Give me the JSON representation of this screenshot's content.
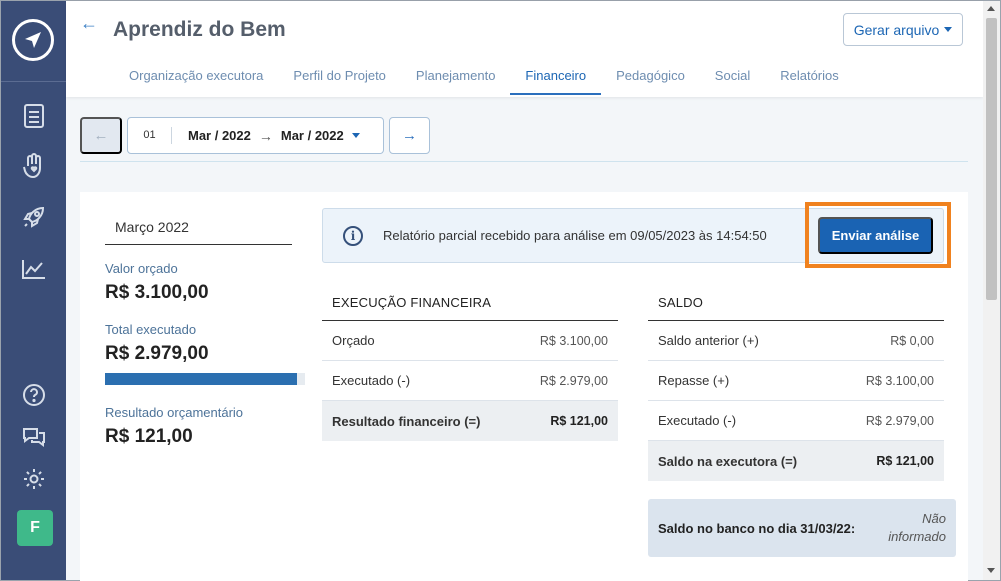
{
  "header": {
    "title": "Aprendiz do Bem",
    "generate_button": "Gerar arquivo"
  },
  "tabs": [
    {
      "label": "Organização executora"
    },
    {
      "label": "Perfil do Projeto"
    },
    {
      "label": "Planejamento"
    },
    {
      "label": "Financeiro",
      "active": true
    },
    {
      "label": "Pedagógico"
    },
    {
      "label": "Social"
    },
    {
      "label": "Relatórios"
    }
  ],
  "period": {
    "number": "01",
    "start": "Mar / 2022",
    "end": "Mar / 2022"
  },
  "summary": {
    "month": "Março 2022",
    "budget_label": "Valor orçado",
    "budget_value": "R$ 3.100,00",
    "executed_label": "Total executado",
    "executed_value": "R$ 2.979,00",
    "executed_fraction": 0.961,
    "result_label": "Resultado orçamentário",
    "result_value": "R$ 121,00"
  },
  "notice": {
    "text": "Relatório parcial recebido para análise em 09/05/2023 às 14:54:50",
    "button": "Enviar análise"
  },
  "execution": {
    "title": "EXECUÇÃO FINANCEIRA",
    "rows": [
      {
        "label": "Orçado",
        "value": "R$ 3.100,00"
      },
      {
        "label": "Executado (-)",
        "value": "R$ 2.979,00"
      },
      {
        "label": "Resultado financeiro (=)",
        "value": "R$ 121,00"
      }
    ]
  },
  "balance": {
    "title": "SALDO",
    "rows": [
      {
        "label": "Saldo anterior (+)",
        "value": "R$ 0,00"
      },
      {
        "label": "Repasse (+)",
        "value": "R$ 3.100,00"
      },
      {
        "label": "Executado (-)",
        "value": "R$ 2.979,00"
      },
      {
        "label": "Saldo na executora (=)",
        "value": "R$ 121,00"
      }
    ],
    "bank_label": "Saldo no banco no dia 31/03/22:",
    "bank_value": "Não informado"
  },
  "user": {
    "initial": "F"
  },
  "colors": {
    "sidebar": "#3a4d77",
    "primary": "#1a63b3",
    "highlight": "#f0821f",
    "avatar": "#3fb98a"
  }
}
